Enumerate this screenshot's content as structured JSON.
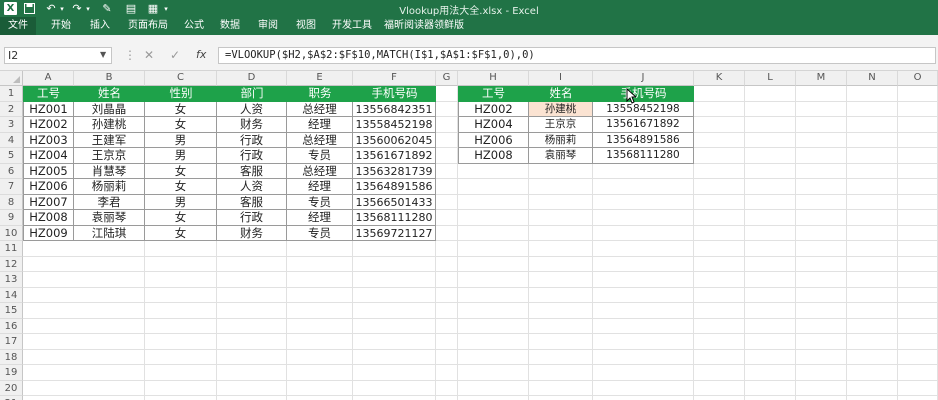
{
  "app": {
    "title": "Vlookup用法大全.xlsx - Excel"
  },
  "quick_access": {
    "save_icon": "save-icon",
    "undo_icon": "undo-icon",
    "redo_icon": "redo-icon"
  },
  "ribbon": {
    "tabs": [
      "文件",
      "开始",
      "插入",
      "页面布局",
      "公式",
      "数据",
      "审阅",
      "视图",
      "开发工具",
      "福昕阅读器领鲜版"
    ]
  },
  "formula_bar": {
    "name_box": "I2",
    "cancel": "✕",
    "enter": "✓",
    "fx": "fx",
    "formula": "=VLOOKUP($H2,$A$2:$F$10,MATCH(I$1,$A$1:$F$1,0),0)"
  },
  "columns": [
    "A",
    "B",
    "C",
    "D",
    "E",
    "F",
    "G",
    "H",
    "I",
    "J",
    "K",
    "L",
    "M",
    "N",
    "O"
  ],
  "rows": [
    "1",
    "2",
    "3",
    "4",
    "5",
    "6",
    "7",
    "8",
    "9",
    "10",
    "11",
    "12",
    "13",
    "14",
    "15",
    "16",
    "17",
    "18",
    "19",
    "20",
    "21"
  ],
  "table_left": {
    "headers": [
      "工号",
      "姓名",
      "性别",
      "部门",
      "职务",
      "手机号码"
    ],
    "rows": [
      [
        "HZ001",
        "刘晶晶",
        "女",
        "人资",
        "总经理",
        "13556842351"
      ],
      [
        "HZ002",
        "孙建桃",
        "女",
        "财务",
        "经理",
        "13558452198"
      ],
      [
        "HZ003",
        "王建军",
        "男",
        "行政",
        "总经理",
        "13560062045"
      ],
      [
        "HZ004",
        "王京京",
        "男",
        "行政",
        "专员",
        "13561671892"
      ],
      [
        "HZ005",
        "肖慧琴",
        "女",
        "客服",
        "总经理",
        "13563281739"
      ],
      [
        "HZ006",
        "杨丽莉",
        "女",
        "人资",
        "经理",
        "13564891586"
      ],
      [
        "HZ007",
        "李君",
        "男",
        "客服",
        "专员",
        "13566501433"
      ],
      [
        "HZ008",
        "袁丽琴",
        "女",
        "行政",
        "经理",
        "13568111280"
      ],
      [
        "HZ009",
        "江陆琪",
        "女",
        "财务",
        "专员",
        "13569721127"
      ]
    ]
  },
  "table_right": {
    "headers": [
      "工号",
      "姓名",
      "手机号码"
    ],
    "rows": [
      [
        "HZ002",
        "孙建桃",
        "13558452198"
      ],
      [
        "HZ004",
        "王京京",
        "13561671892"
      ],
      [
        "HZ006",
        "杨丽莉",
        "13564891586"
      ],
      [
        "HZ008",
        "袁丽琴",
        "13568111280"
      ]
    ]
  },
  "colors": {
    "brand": "#217346",
    "header_fill": "#1ea24a",
    "selected_fill": "#fbe3d2"
  }
}
